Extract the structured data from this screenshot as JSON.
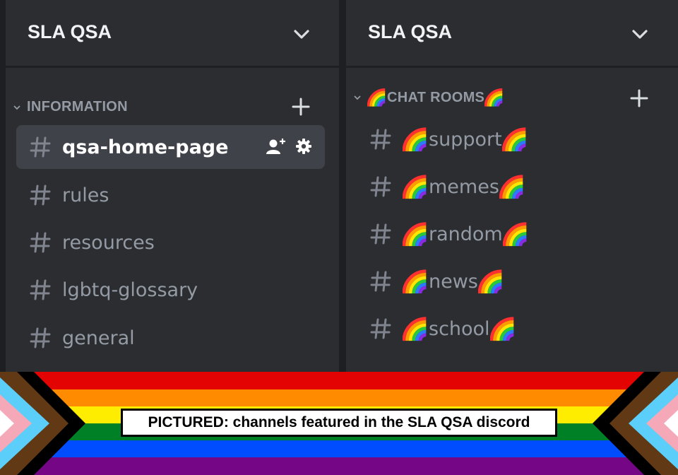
{
  "left_panel": {
    "server_name": "SLA QSA",
    "category": "INFORMATION",
    "channels": [
      {
        "name": "qsa-home-page",
        "selected": true
      },
      {
        "name": "rules"
      },
      {
        "name": "resources"
      },
      {
        "name": "lgbtq-glossary"
      },
      {
        "name": "general"
      }
    ]
  },
  "right_panel": {
    "server_name": "SLA QSA",
    "category": "CHAT ROOMS",
    "channels": [
      {
        "name": "support"
      },
      {
        "name": "memes"
      },
      {
        "name": "random"
      },
      {
        "name": "news"
      },
      {
        "name": "school"
      }
    ]
  },
  "caption": "PICTURED: channels featured in the SLA QSA discord",
  "icons": {
    "collapse": "chevron-down-icon",
    "add_channel": "plus-icon",
    "channel": "hash-icon",
    "invite": "add-member-icon",
    "settings": "gear-icon",
    "emoji": "rainbow-emoji-icon"
  },
  "colors": {
    "background": "#1e1f22",
    "panel": "#2b2d31",
    "selected_row": "#404249",
    "text_muted": "#949ba4",
    "text_bright": "#ffffff",
    "flag_stripes": [
      "#e40303",
      "#ff8c00",
      "#ffed00",
      "#008026",
      "#004dff",
      "#750787"
    ],
    "chevron_colors": [
      "#ffffff",
      "#f5a9b8",
      "#5bcefa",
      "#613915",
      "#000000"
    ]
  }
}
